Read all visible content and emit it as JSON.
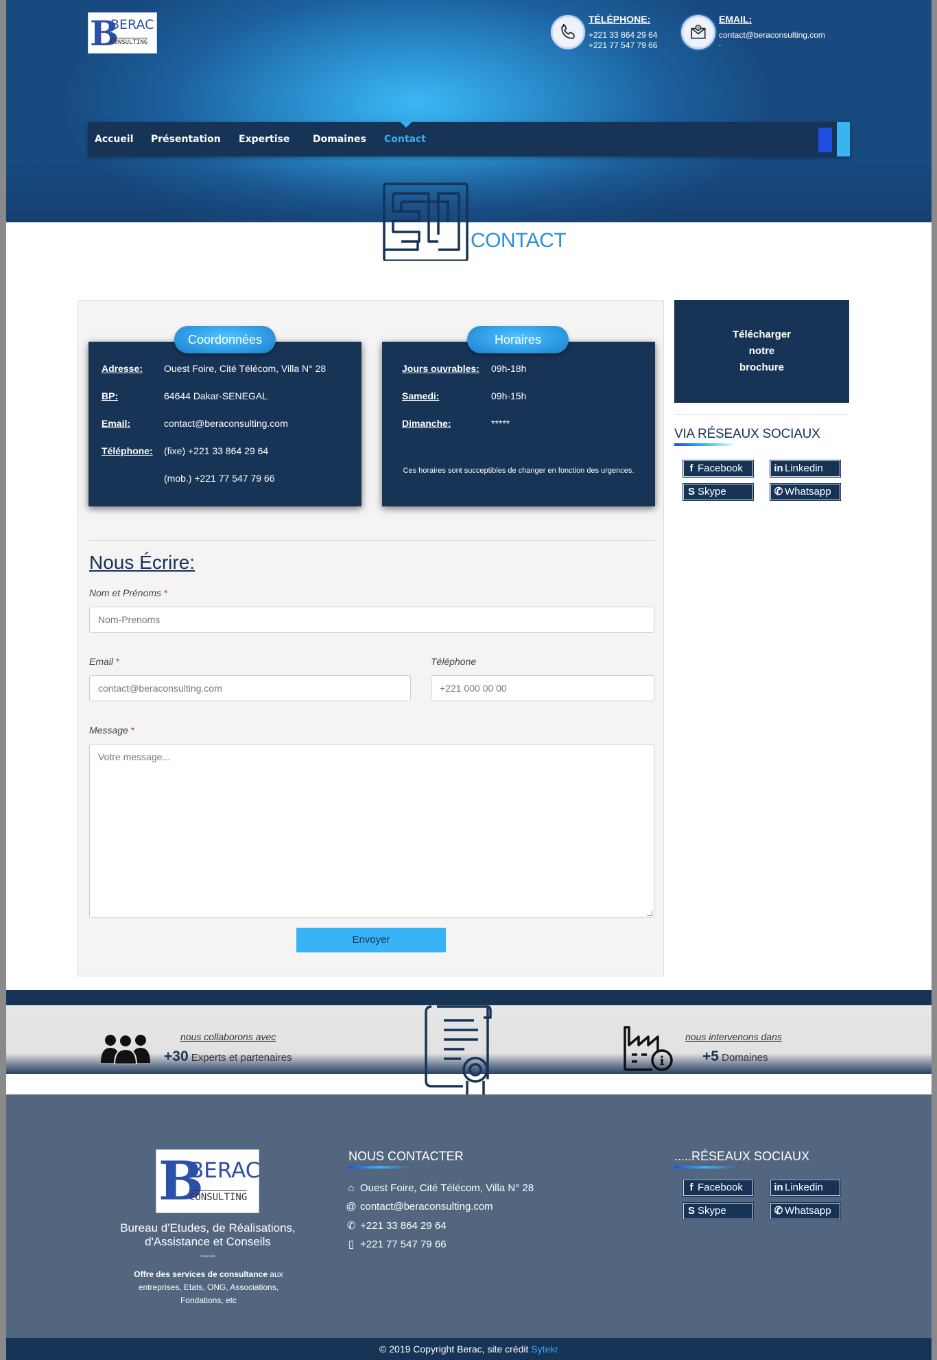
{
  "header": {
    "logo_name": "BERAC",
    "logo_sub": "CONSULTING",
    "phone": {
      "title": "TÉLÉPHONE:",
      "lines": [
        "+221 33 864 29 64",
        "+221 77 547 79 66"
      ]
    },
    "email": {
      "title": "EMAIL:",
      "lines": [
        "contact@beraconsulting.com",
        "."
      ]
    }
  },
  "nav": {
    "items": [
      "Accueil",
      "Présentation",
      "Expertise",
      "Domaines",
      "Contact"
    ],
    "active": "Contact"
  },
  "page_title": "CONTACT",
  "coordonnees": {
    "title": "Coordonnées",
    "rows": [
      {
        "label": "Adresse:",
        "value": "Ouest Foire, Cité Télécom, Villa N° 28"
      },
      {
        "label": "BP:",
        "value": "64644 Dakar-SENEGAL"
      },
      {
        "label": "Email:",
        "value": "contact@beraconsulting.com"
      },
      {
        "label": "Téléphone:",
        "value": "(fixe) +221 33 864 29 64"
      },
      {
        "label": "",
        "value": "(mob.) +221 77 547 79 66"
      }
    ]
  },
  "horaires": {
    "title": "Horaires",
    "rows": [
      {
        "label": "Jours ouvrables:",
        "value": "09h-18h"
      },
      {
        "label": "Samedi:",
        "value": "09h-15h"
      },
      {
        "label": "Dimanche:",
        "value": "*****"
      }
    ],
    "note": "Ces horaires sont succeptibles de changer en fonction des urgences."
  },
  "form": {
    "title": "Nous Écrire:",
    "name_label": "Nom et Prénoms",
    "name_placeholder": "Nom-Prenoms",
    "email_label": "Email",
    "email_placeholder": "contact@beraconsulting.com",
    "phone_label": "Téléphone",
    "phone_placeholder": "+221 000 00 00",
    "message_label": "Message",
    "message_placeholder": "Votre message...",
    "required_mark": "*",
    "submit_label": "Envoyer"
  },
  "sidebar": {
    "brochure_lines": [
      "Télécharger",
      "notre",
      "brochure"
    ],
    "social_title": "VIA RÉSEAUX SOCIAUX",
    "social": [
      "Facebook",
      "Linkedin",
      "Skype",
      "Whatsapp"
    ]
  },
  "stats": [
    {
      "caption": "nous collaborons avec",
      "number": "+30",
      "text": "Experts et partenaires"
    },
    {
      "caption": "nous intervenons dans",
      "number": "+5",
      "text": "Domaines"
    }
  ],
  "footer": {
    "tagline": "Bureau d'Etudes, de Réalisations, d'Assistance et Conseils",
    "stars": "*****",
    "desc_bold": "Offre des services de consultance",
    "desc_rest": " aux entreprises, Etats, ONG, Associations, Fondations, etc",
    "contact_title": "NOUS CONTACTER",
    "contact_lines": [
      {
        "icon": "home-icon",
        "text": "Ouest Foire, Cité Télécom, Villa N° 28"
      },
      {
        "icon": "at-icon",
        "text": "contact@beraconsulting.com"
      },
      {
        "icon": "phone-icon",
        "text": "+221 33 864 29 64"
      },
      {
        "icon": "mobile-icon",
        "text": "+221 77 547 79 66"
      }
    ],
    "social_title": ".....RÉSEAUX SOCIAUX",
    "social": [
      "Facebook",
      "Linkedin",
      "Skype",
      "Whatsapp"
    ]
  },
  "copyright": {
    "text": "© 2019 Copyright Berac, site crédit ",
    "link": "Sytekr"
  },
  "colors": {
    "navy": "#173356",
    "accent": "#38b4f0",
    "footer": "#52667f"
  }
}
